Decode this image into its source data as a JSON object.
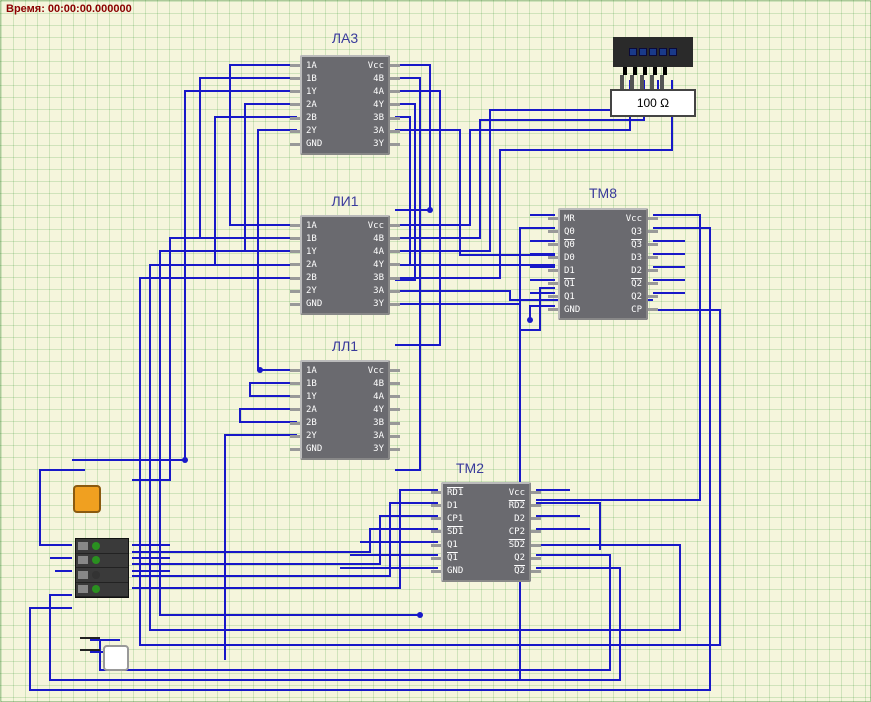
{
  "time_label": "Время: 00:00:00.000000",
  "resistor_value": "100 Ω",
  "chips": {
    "la3": {
      "label": "ЛА3",
      "left_pins": [
        "1A",
        "1B",
        "1Y",
        "2A",
        "2B",
        "2Y",
        "GND"
      ],
      "right_pins": [
        "Vcc",
        "4B",
        "4A",
        "4Y",
        "3B",
        "3A",
        "3Y"
      ]
    },
    "li1": {
      "label": "ЛИ1",
      "left_pins": [
        "1A",
        "1B",
        "1Y",
        "2A",
        "2B",
        "2Y",
        "GND"
      ],
      "right_pins": [
        "Vcc",
        "4B",
        "4A",
        "4Y",
        "3B",
        "3A",
        "3Y"
      ]
    },
    "ll1": {
      "label": "ЛЛ1",
      "left_pins": [
        "1A",
        "1B",
        "1Y",
        "2A",
        "2B",
        "2Y",
        "GND"
      ],
      "right_pins": [
        "Vcc",
        "4B",
        "4A",
        "4Y",
        "3B",
        "3A",
        "3Y"
      ]
    },
    "tm8": {
      "label": "ТМ8",
      "left_pins": [
        "MR",
        "Q0",
        "Q0b",
        "D0",
        "D1",
        "Q1b",
        "Q1",
        "GND"
      ],
      "right_pins": [
        "Vcc",
        "Q3",
        "Q3b",
        "D3",
        "D2",
        "Q2b",
        "Q2",
        "CP"
      ]
    },
    "tm2": {
      "label": "ТМ2",
      "left_pins": [
        "RD1b",
        "D1",
        "CP1",
        "SD1b",
        "Q1",
        "Q1b",
        "GND"
      ],
      "right_pins": [
        "Vcc",
        "RD2b",
        "D2",
        "CP2",
        "SD2b",
        "Q2",
        "Q2b"
      ]
    }
  }
}
